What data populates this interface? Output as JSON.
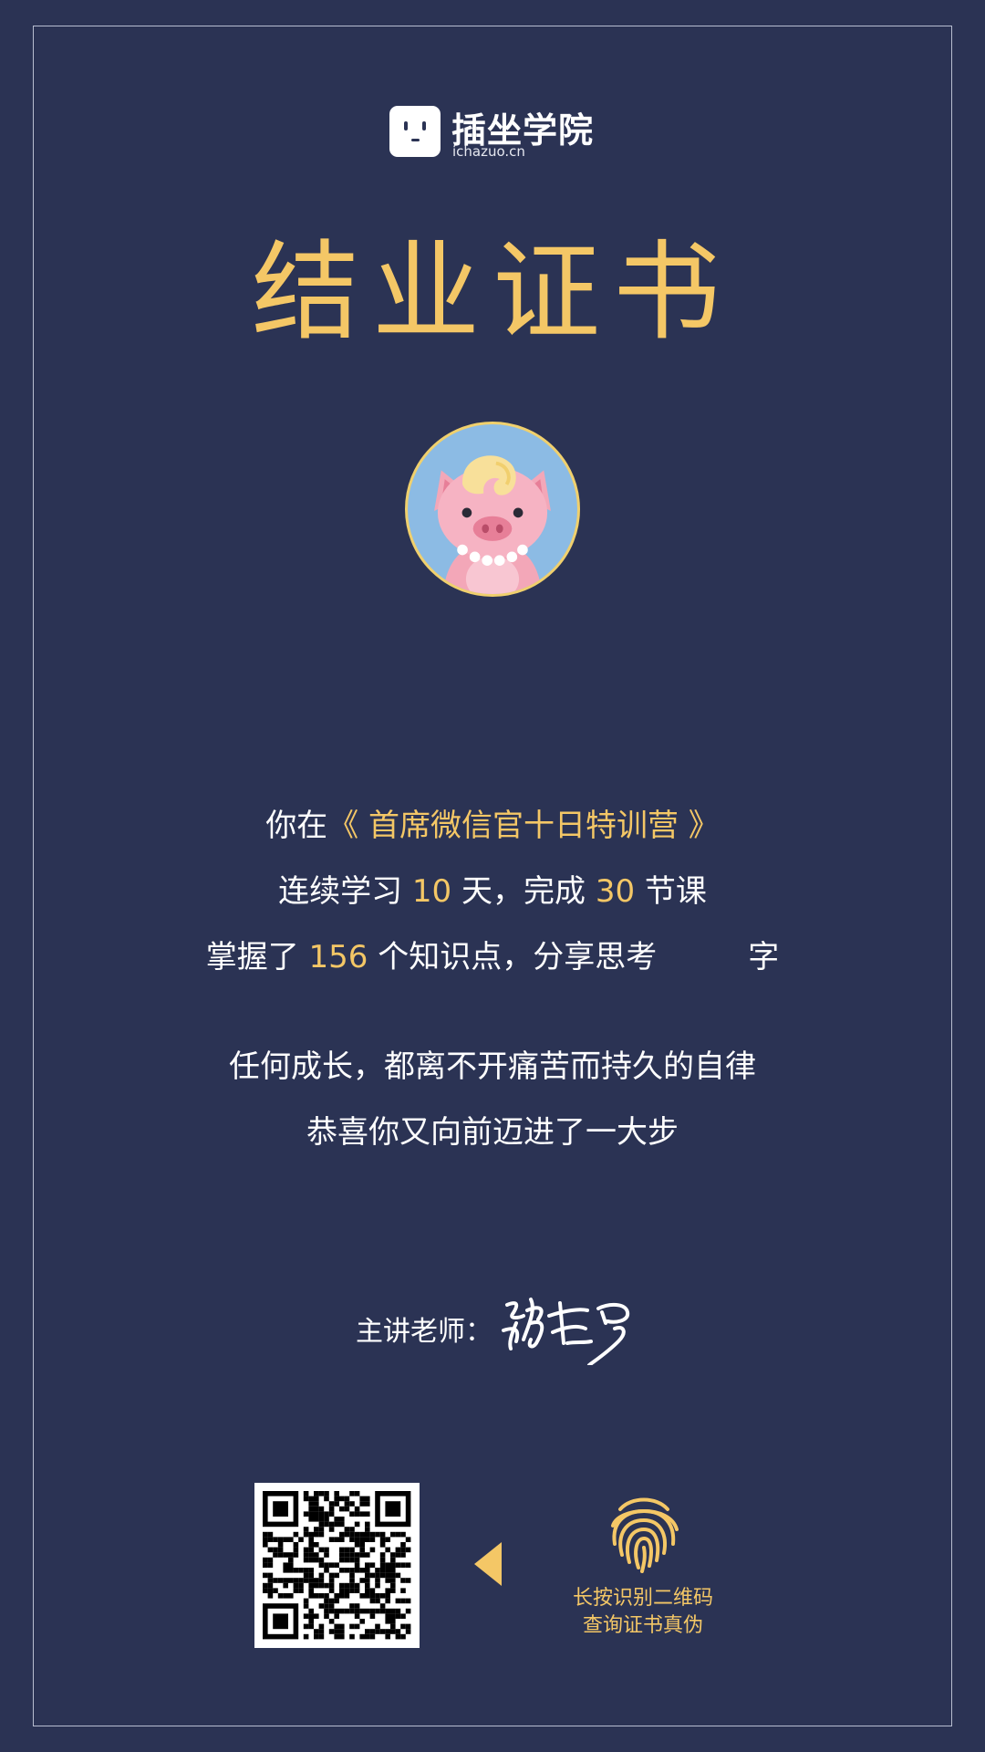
{
  "logo": {
    "name": "插坐学院",
    "domain": "ichazuo.cn",
    "icon": "smiley-box-icon"
  },
  "certificate": {
    "title": "结业证书",
    "avatar_icon": "pig-avatar"
  },
  "summary": {
    "line1_prefix": "你在",
    "course_name": "《 首席微信官十日特训营 》",
    "line2_prefix": "连续学习 ",
    "days": "10",
    "line2_mid": " 天，完成 ",
    "lessons": "30",
    "line2_suffix": " 节课",
    "line3_prefix": "掌握了 ",
    "knowledge_points": "156",
    "line3_mid": " 个知识点，分享思考",
    "line3_suffix": "字",
    "motto1": "任何成长，都离不开痛苦而持久的自律",
    "motto2": "恭喜你又向前迈进了一大步"
  },
  "teacher": {
    "label": "主讲老师：",
    "signature": "张左罗"
  },
  "verify": {
    "hint_line1": "长按识别二维码",
    "hint_line2": "查询证书真伪",
    "icons": [
      "qr-code",
      "arrow-left-icon",
      "fingerprint-icon"
    ]
  },
  "colors": {
    "background": "#2b3354",
    "accent": "#f4c766",
    "text": "#ffffff"
  }
}
